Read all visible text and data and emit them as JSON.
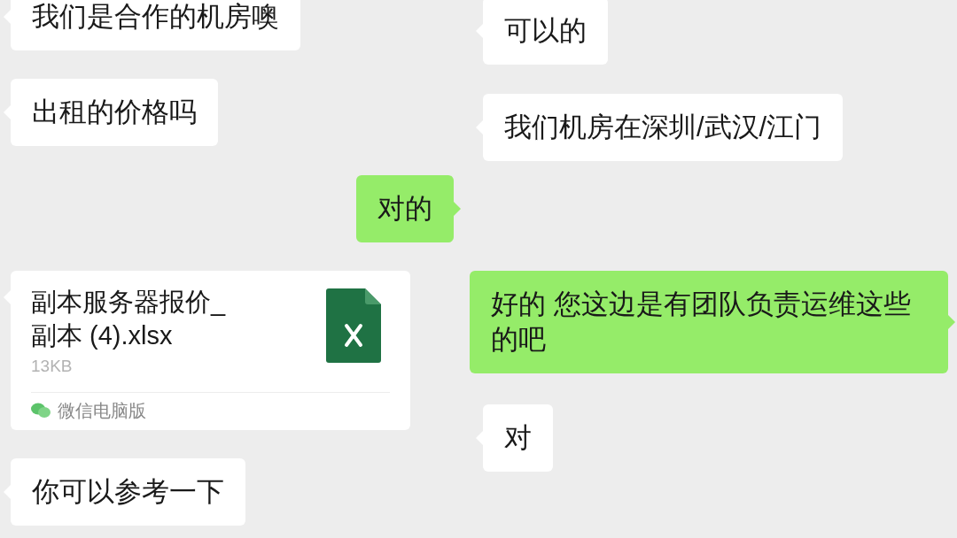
{
  "left_chat": {
    "messages": [
      {
        "kind": "text",
        "outgoing": false,
        "text": "我们是合作的机房噢"
      },
      {
        "kind": "text",
        "outgoing": false,
        "text": "出租的价格吗"
      },
      {
        "kind": "text",
        "outgoing": true,
        "text": "对的"
      },
      {
        "kind": "file",
        "outgoing": false,
        "file_name": "副本服务器报价_副本 (4).xlsx",
        "size": "13KB",
        "source": "微信电脑版"
      },
      {
        "kind": "text",
        "outgoing": false,
        "text": "你可以参考一下"
      }
    ]
  },
  "right_chat": {
    "messages": [
      {
        "kind": "text",
        "outgoing": false,
        "text": "可以的"
      },
      {
        "kind": "text",
        "outgoing": false,
        "text": "我们机房在深圳/武汉/江门"
      },
      {
        "kind": "text",
        "outgoing": true,
        "text": "好的 您这边是有团队负责运维这些的吧"
      },
      {
        "kind": "text",
        "outgoing": false,
        "text": "对"
      }
    ]
  }
}
